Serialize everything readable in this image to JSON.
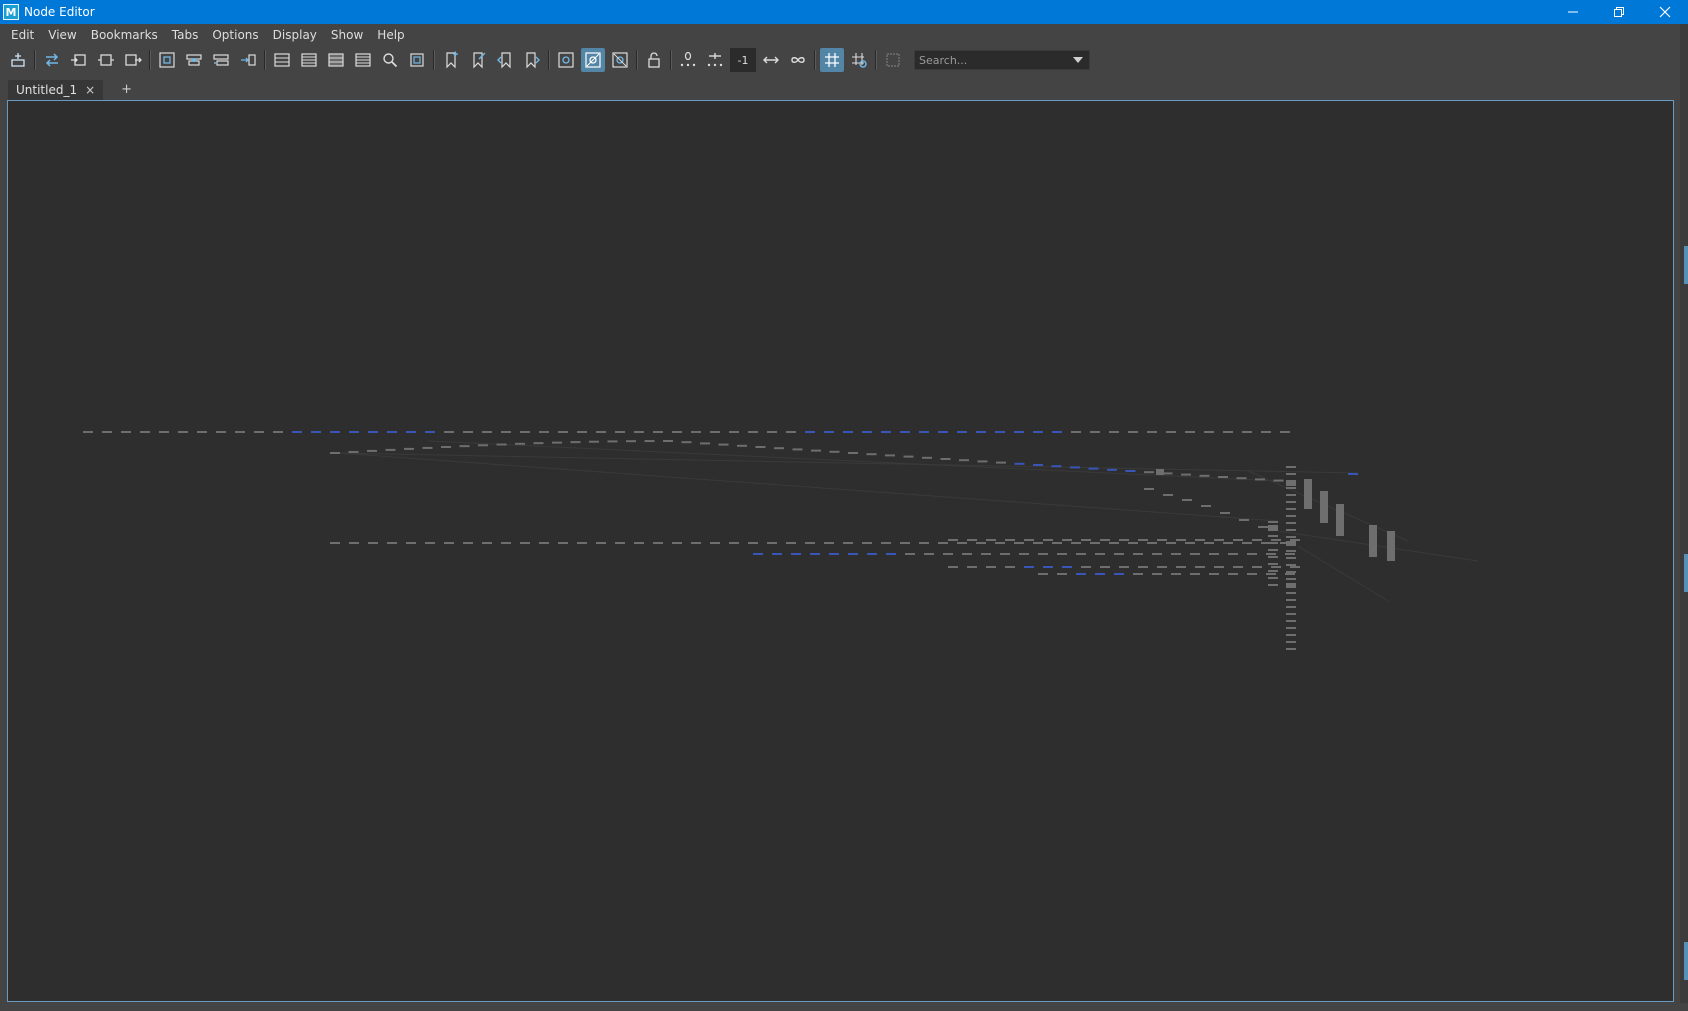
{
  "window": {
    "title": "Node Editor",
    "app_icon_letter": "M"
  },
  "menu": {
    "items": [
      "Edit",
      "View",
      "Bookmarks",
      "Tabs",
      "Options",
      "Display",
      "Show",
      "Help"
    ]
  },
  "toolbar": {
    "graph_depth_value": "-1",
    "search_placeholder": "Search..."
  },
  "tabs": {
    "items": [
      {
        "label": "Untitled_1",
        "close": "×"
      }
    ],
    "add_label": "+"
  },
  "colors": {
    "accent": "#0078d7",
    "canvas_bg": "#2e2e2e",
    "canvas_border": "#6a9ac0",
    "node_gray": "#6e6e6e",
    "node_blue": "#3a55b8",
    "active_button": "#5285a6"
  }
}
